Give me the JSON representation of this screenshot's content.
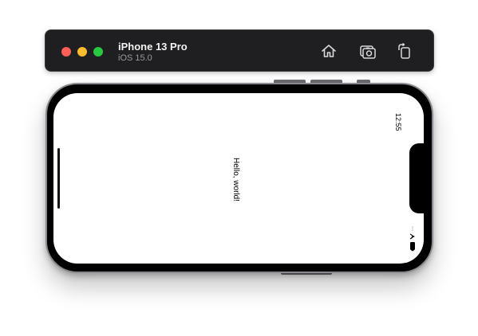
{
  "simulator": {
    "device_name": "iPhone 13 Pro",
    "os_version": "iOS 15.0",
    "toolbar": [
      {
        "name": "home",
        "icon": "home-icon"
      },
      {
        "name": "screenshot",
        "icon": "camera-icon"
      },
      {
        "name": "rotate",
        "icon": "rotate-icon"
      }
    ]
  },
  "status_bar": {
    "time": "12:55",
    "icons": [
      "cellular-icon",
      "wifi-icon",
      "battery-icon"
    ]
  },
  "content": {
    "text": "Hello, world!"
  },
  "colors": {
    "titlebar_bg": "#1f1f21",
    "close": "#ff5f57",
    "minimize": "#febc2e",
    "zoom": "#28c840"
  }
}
